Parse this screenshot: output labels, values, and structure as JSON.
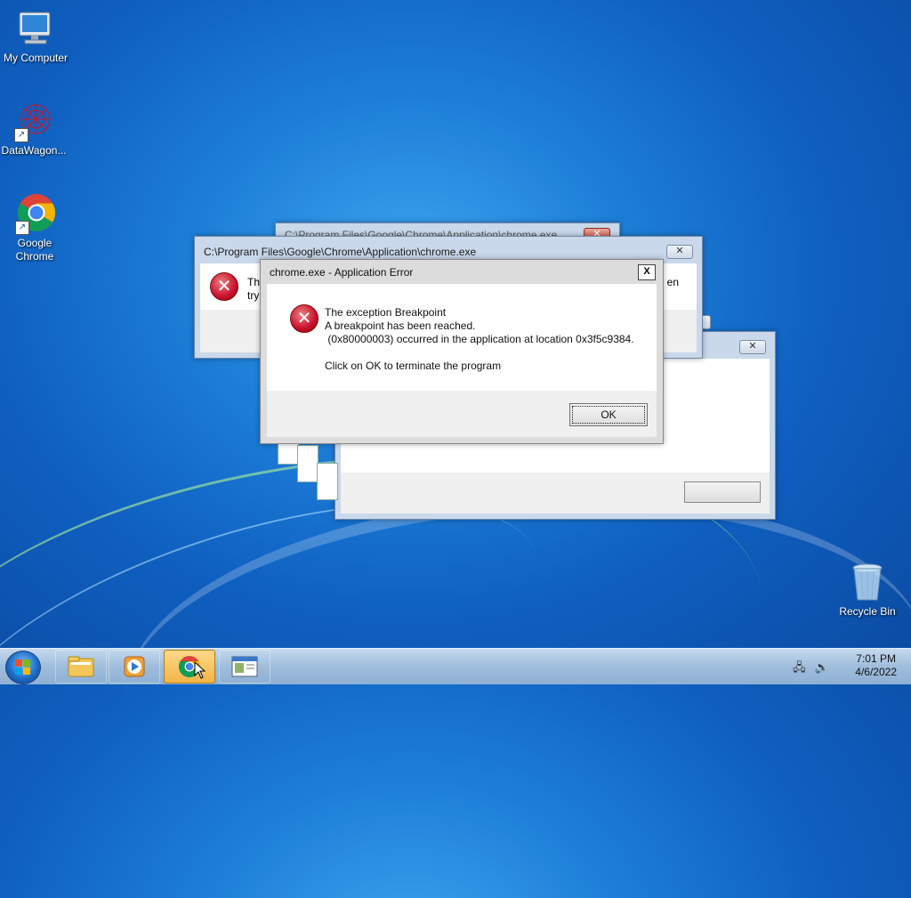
{
  "desktop": {
    "icons": [
      {
        "label": "My Computer"
      },
      {
        "label": "DataWagon..."
      },
      {
        "label": "Google Chrome"
      },
      {
        "label": "Recycle Bin"
      }
    ]
  },
  "background_windows": {
    "back_title_partial": "C:\\Program Files\\Google\\Chrome\\Application\\chrome.exe",
    "mid_title": "C:\\Program Files\\Google\\Chrome\\Application\\chrome.exe",
    "mid_text_line1_start": "Th",
    "mid_text_line2_start": "try",
    "mid_text_line1_end": "en"
  },
  "dialog": {
    "title": "chrome.exe - Application Error",
    "close_label": "X",
    "message": "The exception Breakpoint\nA breakpoint has been reached.\n (0x80000003) occurred in the application at location 0x3f5c9384.\n\nClick on OK to terminate the program",
    "ok_label": "OK"
  },
  "taskbar": {
    "time": "7:01 PM",
    "date": "4/6/2022"
  },
  "colors": {
    "error_red": "#c8102e",
    "taskbar_active": "#f2b546"
  }
}
